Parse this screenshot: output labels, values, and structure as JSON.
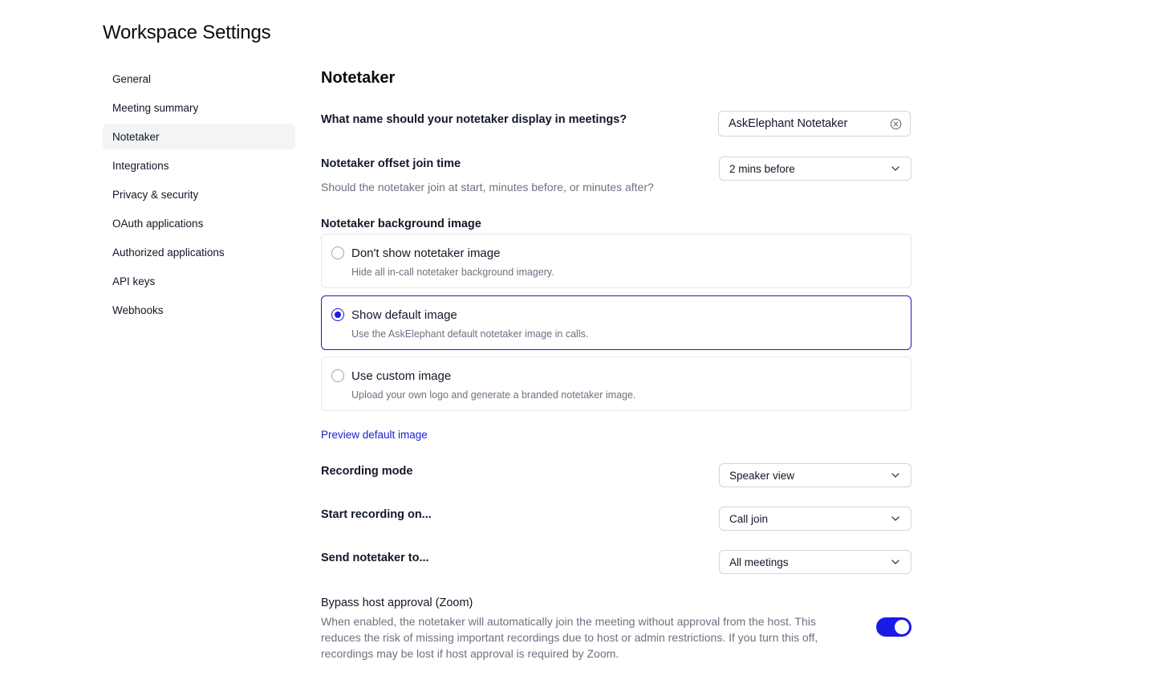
{
  "page": {
    "title": "Workspace Settings"
  },
  "sidebar": {
    "items": [
      {
        "label": "General"
      },
      {
        "label": "Meeting summary"
      },
      {
        "label": "Notetaker",
        "active": true
      },
      {
        "label": "Integrations"
      },
      {
        "label": "Privacy & security"
      },
      {
        "label": "OAuth applications"
      },
      {
        "label": "Authorized applications"
      },
      {
        "label": "API keys"
      },
      {
        "label": "Webhooks"
      }
    ]
  },
  "main": {
    "section_title": "Notetaker",
    "display_name": {
      "label": "What name should your notetaker display in meetings?",
      "value": "AskElephant Notetaker",
      "clear_icon": "circle-x-icon"
    },
    "offset_join": {
      "label": "Notetaker offset join time",
      "description": "Should the notetaker join at start, minutes before, or minutes after?",
      "selected": "2 mins before"
    },
    "background_image": {
      "label": "Notetaker background image",
      "options": [
        {
          "title": "Don't show notetaker image",
          "description": "Hide all in-call notetaker background imagery.",
          "checked": false
        },
        {
          "title": "Show default image",
          "description": "Use the AskElephant default notetaker image in calls.",
          "checked": true
        },
        {
          "title": "Use custom image",
          "description": "Upload your own logo and generate a branded notetaker image.",
          "checked": false
        }
      ],
      "preview_link": "Preview default image"
    },
    "recording_mode": {
      "label": "Recording mode",
      "selected": "Speaker view"
    },
    "start_recording": {
      "label": "Start recording on...",
      "selected": "Call join"
    },
    "send_to": {
      "label": "Send notetaker to...",
      "selected": "All meetings"
    },
    "bypass": {
      "title": "Bypass host approval (Zoom)",
      "description": "When enabled, the notetaker will automatically join the meeting without approval from the host. This reduces the risk of missing important recordings due to host or admin restrictions. If you turn this off, recordings may be lost if host approval is required by Zoom.",
      "enabled": true
    }
  },
  "colors": {
    "accent": "#1a1ae6",
    "selected_border": "#1d1db8",
    "muted_text": "#6b7280",
    "border": "#e5e7eb"
  }
}
